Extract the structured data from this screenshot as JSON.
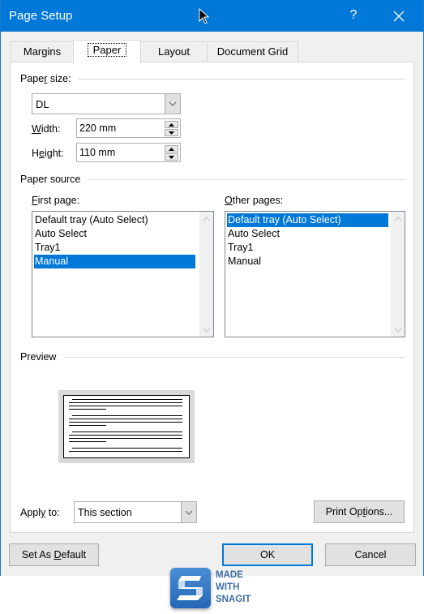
{
  "window": {
    "title": "Page Setup",
    "help_label": "?",
    "close_icon": "close-icon"
  },
  "tabs": [
    {
      "label": "Margins",
      "active": false
    },
    {
      "label": "Paper",
      "active": true
    },
    {
      "label": "Layout",
      "active": false
    },
    {
      "label": "Document Grid",
      "active": false
    }
  ],
  "paper_size": {
    "group_label_pre": "Pape",
    "group_label_u": "r",
    "group_label_post": " size:",
    "selected": "DL",
    "width_label_u": "W",
    "width_label_post": "idth:",
    "width_value": "220 mm",
    "height_label_pre": "H",
    "height_label_u": "e",
    "height_label_post": "ight:",
    "height_value": "110 mm"
  },
  "paper_source": {
    "group_label": "Paper source",
    "first_page": {
      "label_u": "F",
      "label_post": "irst page:",
      "items": [
        "Default tray (Auto Select)",
        "Auto Select",
        "Tray1",
        "Manual"
      ],
      "selected_index": 3
    },
    "other_pages": {
      "label_u": "O",
      "label_post": "ther pages:",
      "items": [
        "Default tray (Auto Select)",
        "Auto Select",
        "Tray1",
        "Manual"
      ],
      "selected_index": 0
    }
  },
  "preview": {
    "group_label": "Preview"
  },
  "apply_to": {
    "label_pre": "Appl",
    "label_u": "y",
    "label_post": " to:",
    "selected": "This section"
  },
  "buttons": {
    "print_options_pre": "Print Op",
    "print_options_u": "t",
    "print_options_post": "ions...",
    "set_default_pre": "Set As ",
    "set_default_u": "D",
    "set_default_post": "efault",
    "ok": "OK",
    "cancel": "Cancel"
  },
  "watermark": {
    "line1": "MADE",
    "line2": "WITH",
    "line3": "SNAGIT"
  },
  "colors": {
    "accent": "#0078d7",
    "selection": "#0078d7"
  }
}
